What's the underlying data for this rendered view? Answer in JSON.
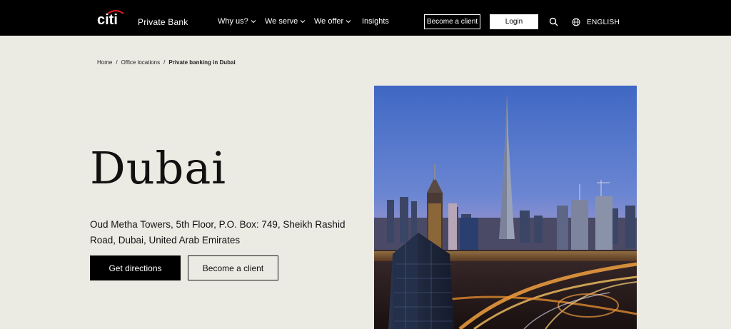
{
  "header": {
    "brand_subtitle": "Private Bank",
    "nav": [
      {
        "label": "Why us?",
        "has_dropdown": true
      },
      {
        "label": "We serve",
        "has_dropdown": true
      },
      {
        "label": "We offer",
        "has_dropdown": true
      },
      {
        "label": "Insights",
        "has_dropdown": false
      }
    ],
    "become_client_label": "Become a client",
    "login_label": "Login",
    "language_label": "ENGLISH",
    "icons": {
      "search": "search-icon",
      "language": "globe-icon",
      "logo": "citi-logo"
    }
  },
  "breadcrumb": {
    "items": [
      "Home",
      "Office locations"
    ],
    "current": "Private banking in Dubai"
  },
  "hero": {
    "title": "Dubai",
    "address": "Oud Metha Towers, 5th Floor, P.O. Box: 749, Sheikh Rashid Road, Dubai, United Arab Emirates",
    "primary_button": "Get directions",
    "secondary_button": "Become a client"
  },
  "colors": {
    "header_bg": "#000000",
    "page_bg": "#ecebe3",
    "logo_arc": "#e31b23"
  }
}
